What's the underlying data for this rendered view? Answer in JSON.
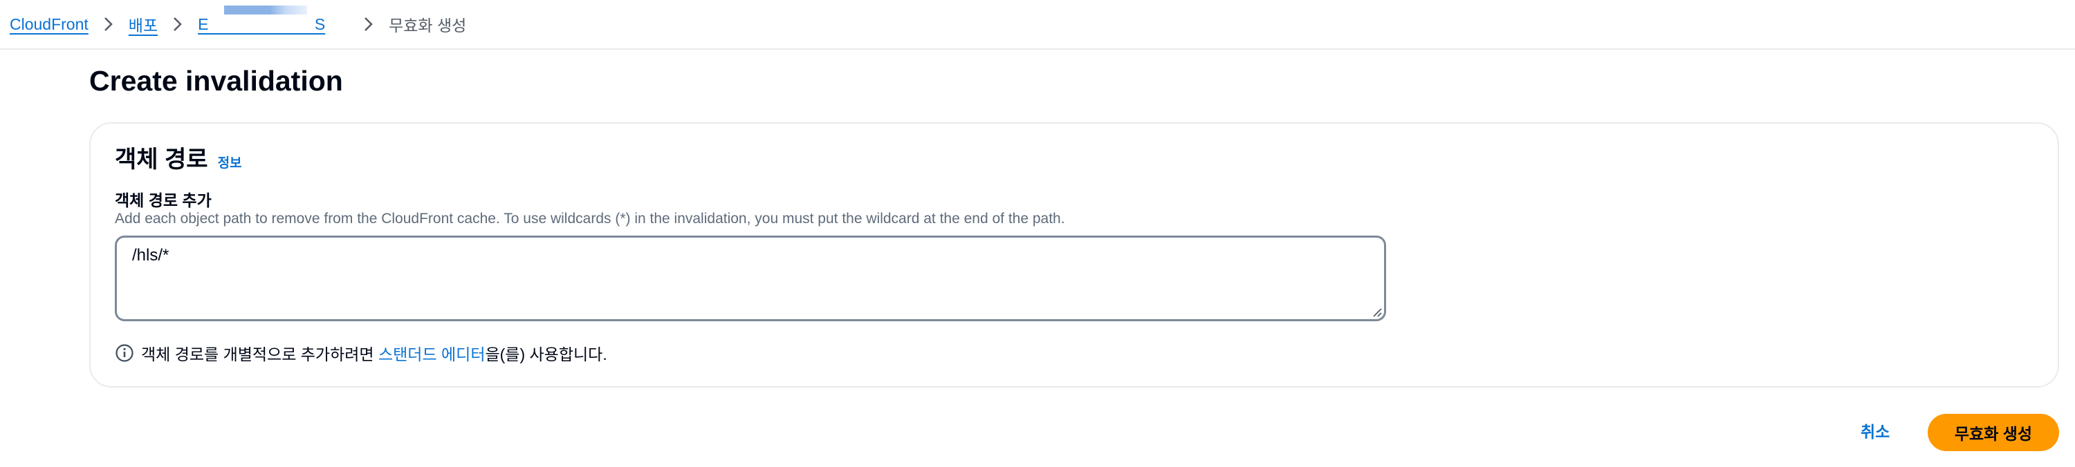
{
  "breadcrumb": {
    "items": [
      {
        "label": "CloudFront"
      },
      {
        "label": "배포"
      },
      {
        "label": "E                        S"
      }
    ],
    "current": "무효화 생성"
  },
  "page": {
    "title": "Create invalidation"
  },
  "object_paths": {
    "title": "객체 경로",
    "info_link": "정보",
    "field_label": "객체 경로 추가",
    "field_description": "Add each object path to remove from the CloudFront cache. To use wildcards (*) in the invalidation, you must put the wildcard at the end of the path.",
    "textarea_value": "/hls/*",
    "help_prefix": "객체 경로를 개별적으로 추가하려면 ",
    "help_link": "스탠더드 에디터",
    "help_suffix": "을(를) 사용합니다."
  },
  "actions": {
    "cancel_label": "취소",
    "submit_label": "무효화 생성"
  },
  "colors": {
    "link": "#0972d3",
    "primary": "#ff9900",
    "text": "#000716",
    "muted": "#5f6b7a"
  },
  "icons": [
    "chevron-right-icon",
    "info-circle-icon",
    "resize-handle-icon"
  ]
}
